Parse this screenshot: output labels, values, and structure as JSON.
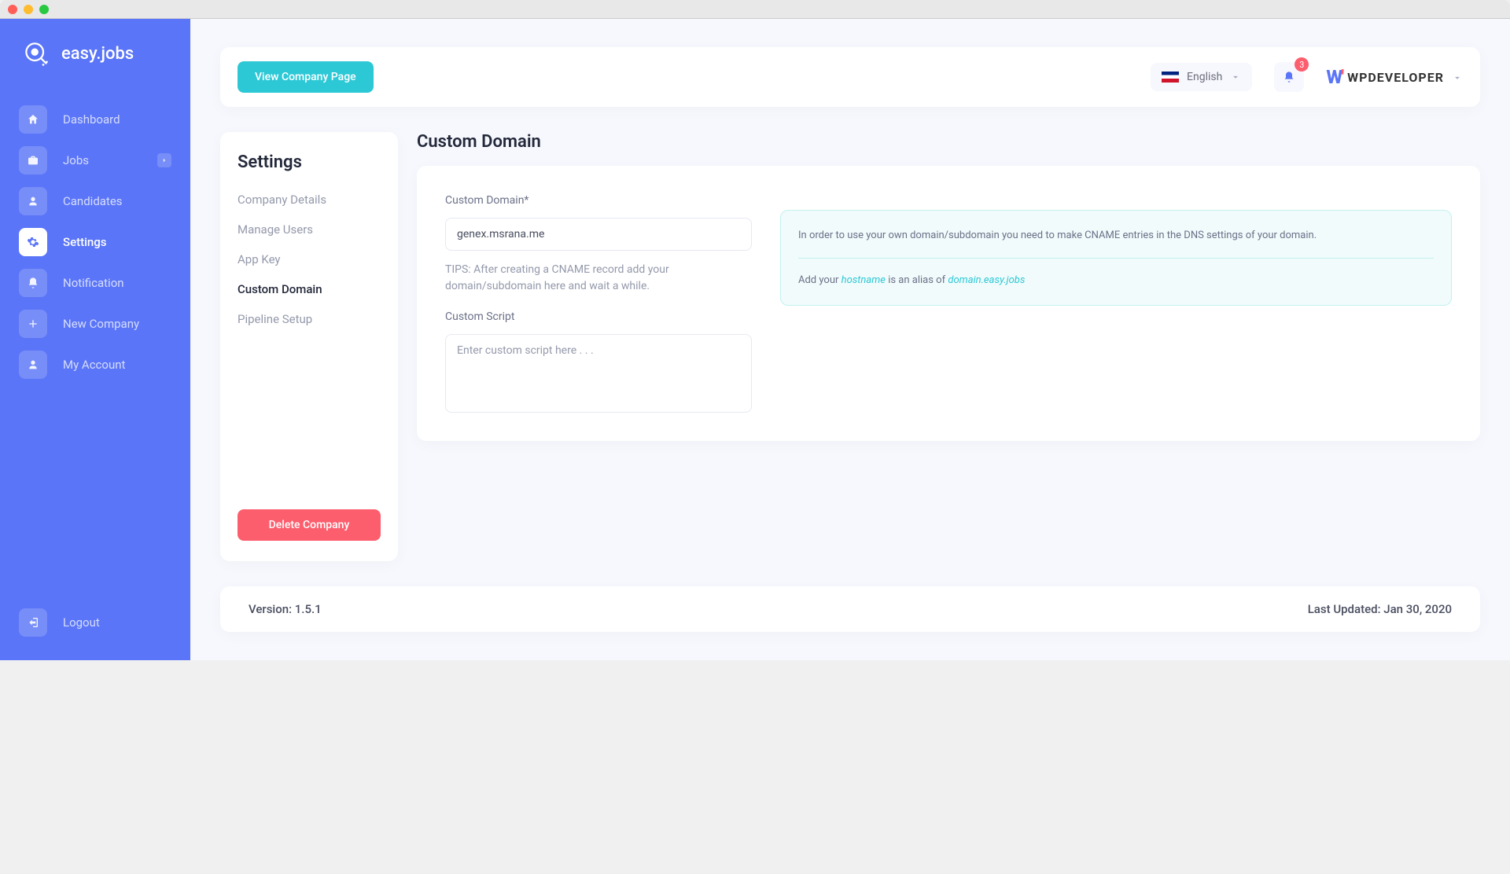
{
  "brand": "easy.jobs",
  "nav": {
    "dashboard": "Dashboard",
    "jobs": "Jobs",
    "candidates": "Candidates",
    "settings": "Settings",
    "notification": "Notification",
    "new_company": "New Company",
    "my_account": "My Account",
    "logout": "Logout"
  },
  "topbar": {
    "view_company": "View Company Page",
    "language": "English",
    "notification_count": "3",
    "company_name": "WPDEVELOPER"
  },
  "settings_panel": {
    "title": "Settings",
    "items": {
      "company_details": "Company Details",
      "manage_users": "Manage Users",
      "app_key": "App Key",
      "custom_domain": "Custom Domain",
      "pipeline_setup": "Pipeline Setup"
    },
    "delete": "Delete Company"
  },
  "page": {
    "title": "Custom Domain",
    "domain_label": "Custom Domain*",
    "domain_value": "genex.msrana.me",
    "tips": "TIPS: After creating a CNAME record add your domain/subdomain here and wait a while.",
    "script_label": "Custom Script",
    "script_placeholder": "Enter custom script here . . .",
    "info_text": "In order to use your own domain/subdomain you need to make CNAME entries in the DNS settings of your domain.",
    "info_prefix": "Add your ",
    "info_hostname": "hostname",
    "info_mid": " is an alias of ",
    "info_domain": "domain.easy.jobs"
  },
  "footer": {
    "version": "Version: 1.5.1",
    "updated": "Last Updated: Jan 30, 2020"
  }
}
